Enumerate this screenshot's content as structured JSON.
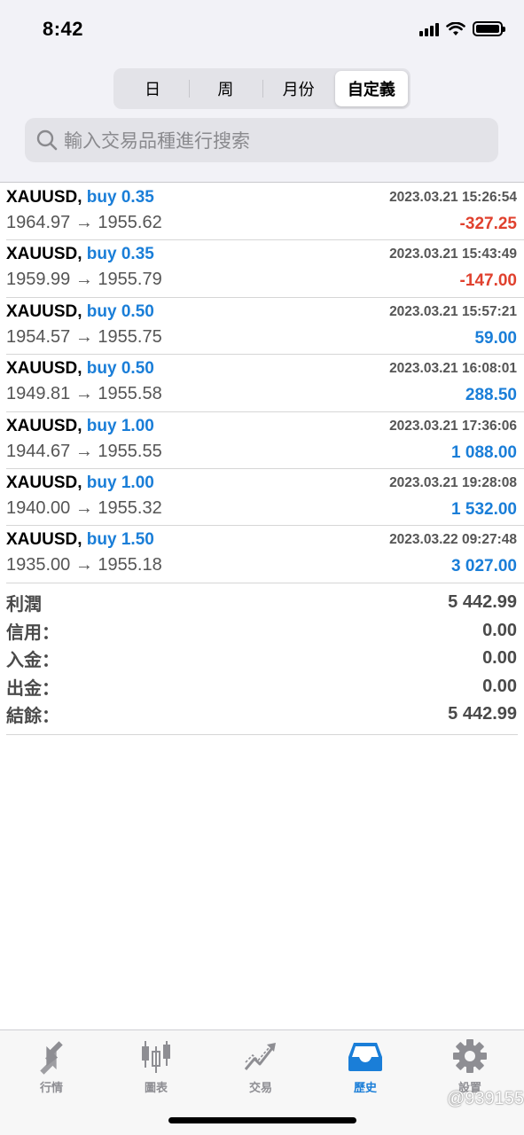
{
  "status_bar": {
    "time": "8:42"
  },
  "period_tabs": [
    {
      "label": "日",
      "active": false
    },
    {
      "label": "周",
      "active": false
    },
    {
      "label": "月份",
      "active": false
    },
    {
      "label": "自定義",
      "active": true
    }
  ],
  "search": {
    "placeholder": "輸入交易品種進行搜索"
  },
  "deals": [
    {
      "symbol": "XAUUSD",
      "sep": ",",
      "side": "buy 0.35",
      "datetime": "2023.03.21 15:26:54",
      "prices": "1964.97 → 1955.62",
      "profit": "-327.25",
      "sign": "neg"
    },
    {
      "symbol": "XAUUSD",
      "sep": ",",
      "side": "buy 0.35",
      "datetime": "2023.03.21 15:43:49",
      "prices": "1959.99 → 1955.79",
      "profit": "-147.00",
      "sign": "neg"
    },
    {
      "symbol": "XAUUSD",
      "sep": ",",
      "side": "buy 0.50",
      "datetime": "2023.03.21 15:57:21",
      "prices": "1954.57 → 1955.75",
      "profit": "59.00",
      "sign": "pos"
    },
    {
      "symbol": "XAUUSD",
      "sep": ",",
      "side": "buy 0.50",
      "datetime": "2023.03.21 16:08:01",
      "prices": "1949.81 → 1955.58",
      "profit": "288.50",
      "sign": "pos"
    },
    {
      "symbol": "XAUUSD",
      "sep": ",",
      "side": "buy 1.00",
      "datetime": "2023.03.21 17:36:06",
      "prices": "1944.67 → 1955.55",
      "profit": "1 088.00",
      "sign": "pos"
    },
    {
      "symbol": "XAUUSD",
      "sep": ",",
      "side": "buy 1.00",
      "datetime": "2023.03.21 19:28:08",
      "prices": "1940.00 → 1955.32",
      "profit": "1 532.00",
      "sign": "pos"
    },
    {
      "symbol": "XAUUSD",
      "sep": ",",
      "side": "buy 1.50",
      "datetime": "2023.03.22 09:27:48",
      "prices": "1935.00 → 1955.18",
      "profit": "3 027.00",
      "sign": "pos"
    }
  ],
  "summary": [
    {
      "label": "利潤",
      "value": "5 442.99"
    },
    {
      "label": "信用：",
      "value": "0.00"
    },
    {
      "label": "入金：",
      "value": "0.00"
    },
    {
      "label": "出金：",
      "value": "0.00"
    },
    {
      "label": "結餘：",
      "value": "5 442.99"
    }
  ],
  "tabbar": [
    {
      "label": "行情",
      "icon": "quotes-icon",
      "active": false
    },
    {
      "label": "圖表",
      "icon": "chart-icon",
      "active": false
    },
    {
      "label": "交易",
      "icon": "trade-icon",
      "active": false
    },
    {
      "label": "歷史",
      "icon": "history-icon",
      "active": true
    },
    {
      "label": "設置",
      "icon": "settings-icon",
      "active": false
    }
  ],
  "watermark": "@939155",
  "colors": {
    "accent": "#1a7ed8",
    "loss": "#e0412e",
    "inactive": "#8e8e93"
  }
}
